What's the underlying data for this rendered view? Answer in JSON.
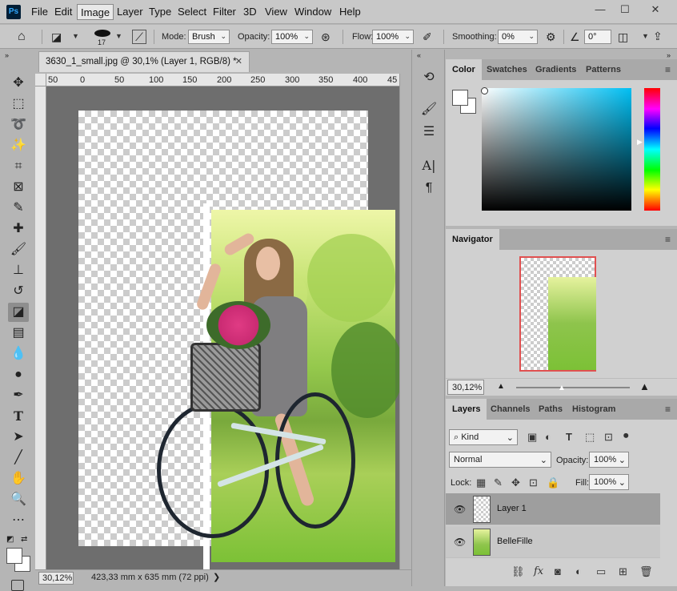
{
  "app": {
    "logo": "Ps"
  },
  "menubar": {
    "items": [
      "File",
      "Edit",
      "Image",
      "Layer",
      "Type",
      "Select",
      "Filter",
      "3D",
      "View",
      "Window",
      "Help"
    ],
    "active": "Image",
    "win_minimize": "—",
    "win_maximize": "☐",
    "win_close": "✕"
  },
  "options": {
    "brush_size": "17",
    "mode_label": "Mode:",
    "mode_value": "Brush",
    "opacity_label": "Opacity:",
    "opacity_value": "100%",
    "flow_label": "Flow:",
    "flow_value": "100%",
    "smoothing_label": "Smoothing:",
    "smoothing_value": "0%",
    "angle_value": "0°"
  },
  "document": {
    "tab_title": "3630_1_small.jpg @ 30,1% (Layer 1, RGB/8) *",
    "tab_close": "✕",
    "ruler_ticks": [
      "50",
      "0",
      "50",
      "100",
      "150",
      "200",
      "250",
      "300",
      "350",
      "400",
      "45"
    ],
    "status_zoom": "30,12%",
    "status_info": "423,33 mm x 635 mm (72 ppi)",
    "status_arrow": "❯"
  },
  "color_panel": {
    "tabs": [
      "Color",
      "Swatches",
      "Gradients",
      "Patterns"
    ],
    "active_tab": "Color",
    "foreground": "#ffffff",
    "background": "#ffffff"
  },
  "navigator": {
    "tab": "Navigator",
    "zoom": "30,12%"
  },
  "layers_panel": {
    "tabs": [
      "Layers",
      "Channels",
      "Paths",
      "Histogram"
    ],
    "active_tab": "Layers",
    "filter_kind": "Kind",
    "blend_mode": "Normal",
    "opacity_label": "Opacity:",
    "opacity_value": "100%",
    "lock_label": "Lock:",
    "fill_label": "Fill:",
    "fill_value": "100%",
    "layers": [
      {
        "name": "Layer 1",
        "selected": true
      },
      {
        "name": "BelleFille",
        "selected": false
      }
    ]
  },
  "colors": {
    "accent": "#31a8ff",
    "nav_frame": "#e05050"
  }
}
